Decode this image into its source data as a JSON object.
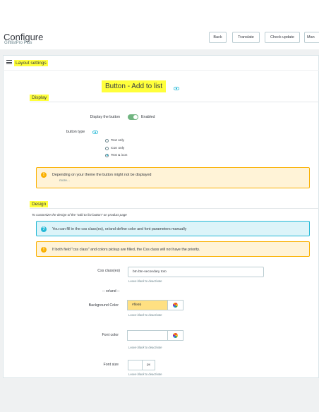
{
  "header": {
    "title": "Configure",
    "subtitle": "GiftlistPro Plus",
    "toolbar": {
      "back": "Back",
      "translate": "Translate",
      "check_update": "Check update",
      "more": "Man"
    }
  },
  "panel": {
    "heading": "Layout settings",
    "section_title": "Button - Add to list"
  },
  "display": {
    "heading": "Display",
    "display_button_label": "Display the button",
    "display_button_state": "Enabled",
    "button_type_label": "button type",
    "options": [
      "Text only",
      "Icon only",
      "Text & icon"
    ],
    "selected_option": "Text & icon",
    "theme_alert": "Depending on your theme the button might not be displayed",
    "more": "more..."
  },
  "design": {
    "heading": "Design",
    "help": "To customize the design of the \"add to list button\" on product page",
    "info_alert": "You can fill in the css class(es), or/and define color and font parameters manually",
    "priority_alert": "If both field \"css class\" and colors pickup are filled, the Css class will not have the priority.",
    "css_label": "Css class(es)",
    "css_value": "btn btn-secondary toto",
    "leave_blank": "Leave blank to deactivate",
    "or_and": "-- or/and --",
    "bg_label": "Background Color",
    "bg_value": "#ffe9b",
    "font_color_label": "Font color",
    "font_color_value": "",
    "font_size_label": "Font size",
    "font_size_value": "",
    "font_size_unit": "px"
  },
  "colors": {
    "accent": "#25b9d7",
    "toggle_on": "#70b580",
    "warning": "#fab000",
    "highlight": "#ffff3b",
    "bg_swatch": "#ffe082"
  },
  "icons": [
    "list-icon",
    "eye-icon",
    "warning-icon",
    "help-icon",
    "color-picker-icon"
  ]
}
